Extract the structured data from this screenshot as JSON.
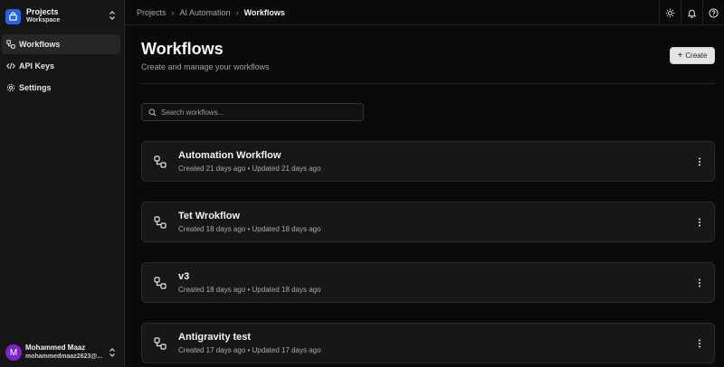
{
  "workspace": {
    "name": "Projects",
    "subtitle": "Workspace"
  },
  "sidebar": {
    "items": [
      {
        "label": "Workflows",
        "icon": "workflow-icon",
        "active": true
      },
      {
        "label": "API Keys",
        "icon": "code-icon",
        "active": false
      },
      {
        "label": "Settings",
        "icon": "gear-icon",
        "active": false
      }
    ]
  },
  "user": {
    "initial": "M",
    "name": "Mohammed Maaz",
    "email": "mohammedmaaz2623@..."
  },
  "breadcrumb": {
    "items": [
      "Projects",
      "AI Automation"
    ],
    "current": "Workflows"
  },
  "header": {
    "title": "Workflows",
    "subtitle": "Create and manage your workflows",
    "create_label": "Create"
  },
  "search": {
    "placeholder": "Search workflows..."
  },
  "workflows": [
    {
      "name": "Automation Workflow",
      "meta": "Created 21 days ago • Updated 21 days ago"
    },
    {
      "name": "Tet Wrokflow",
      "meta": "Created 18 days ago • Updated 18 days ago"
    },
    {
      "name": "v3",
      "meta": "Created 18 days ago • Updated 18 days ago"
    },
    {
      "name": "Antigravity test",
      "meta": "Created 17 days ago • Updated 17 days ago"
    }
  ],
  "colors": {
    "accent": "#2563eb",
    "avatar": "#7e22ce",
    "background": "#0a0a0a"
  }
}
